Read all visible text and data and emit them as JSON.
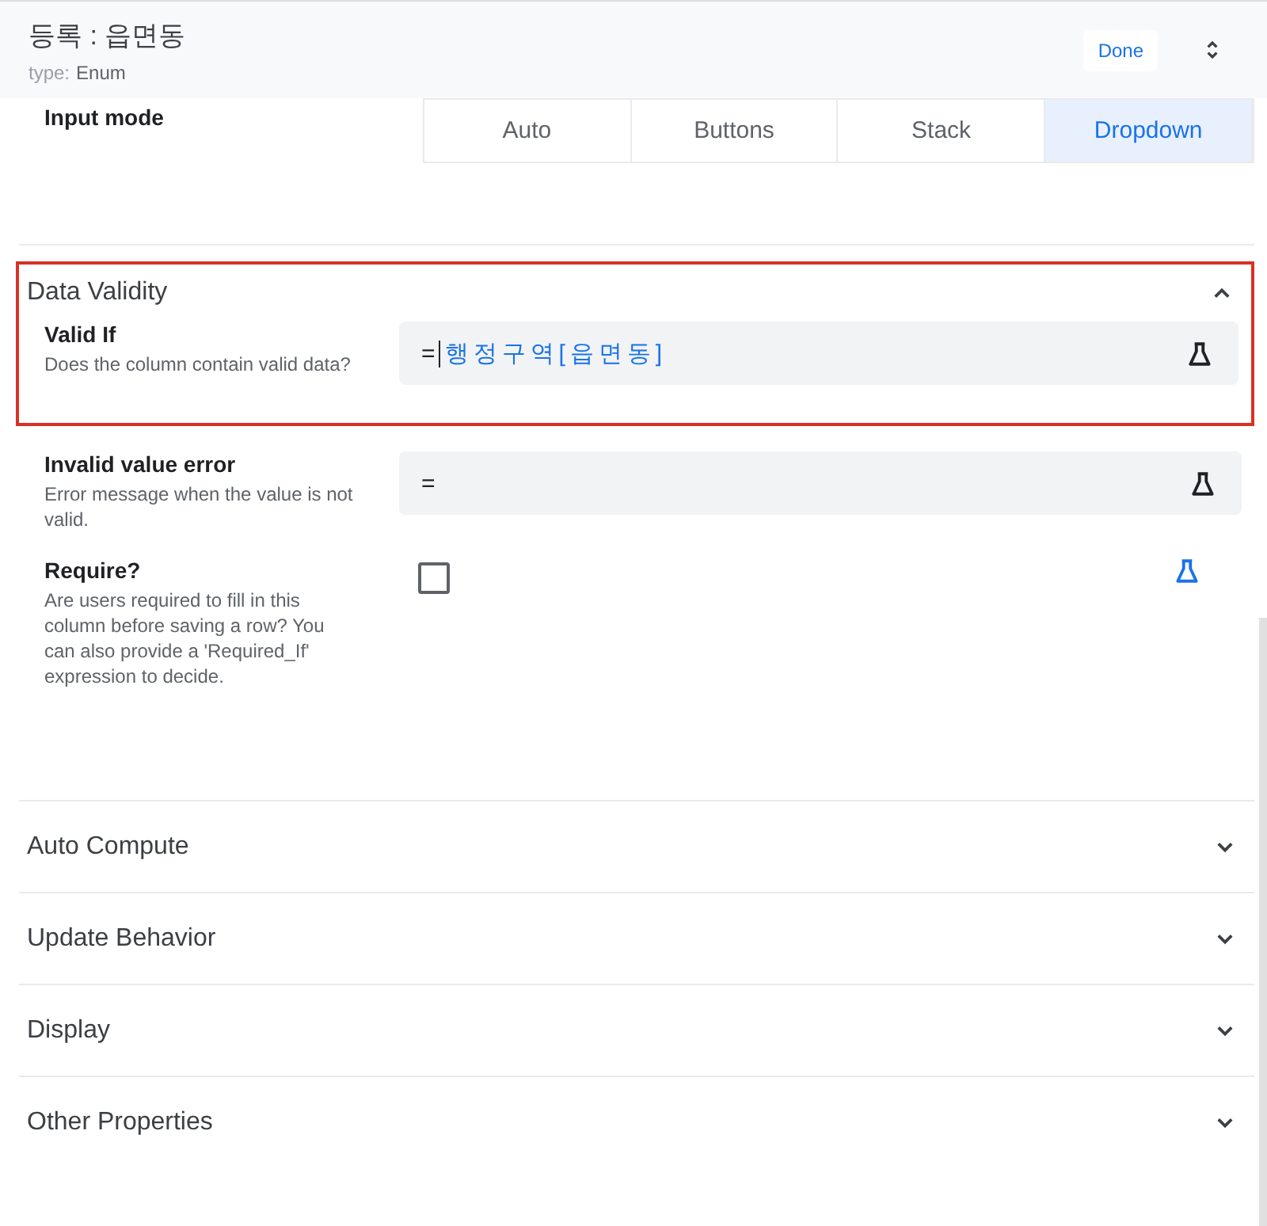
{
  "header": {
    "title": "등록 : 읍면동",
    "type_label": "type:",
    "type_value": "Enum",
    "done": "Done"
  },
  "input_mode": {
    "label": "Input mode",
    "options": [
      {
        "label": "Auto",
        "selected": false
      },
      {
        "label": "Buttons",
        "selected": false
      },
      {
        "label": "Stack",
        "selected": false
      },
      {
        "label": "Dropdown",
        "selected": true
      }
    ]
  },
  "sections": [
    {
      "title": "Data Validity",
      "expanded": true,
      "fields": [
        {
          "kind": "formula",
          "label": "Valid If",
          "description": "Does the column contain valid data?",
          "prefix": "=",
          "value": "행정구역[읍면동]",
          "highlighted": true,
          "formula_on": false
        },
        {
          "kind": "formula",
          "label": "Invalid value error",
          "description": "Error message when the value is not valid.",
          "prefix": "=",
          "highlighted": false,
          "formula_on": false
        },
        {
          "kind": "checkbox",
          "label": "Require?",
          "description": "Are users required to fill in this column before saving a row? You can also provide a 'Required_If' expression to decide.",
          "checked": false,
          "highlighted": false,
          "formula_on": true
        }
      ]
    },
    {
      "title": "Auto Compute",
      "expanded": false
    },
    {
      "title": "Update Behavior",
      "expanded": false
    },
    {
      "title": "Display",
      "expanded": false
    },
    {
      "title": "Other Properties",
      "expanded": false
    }
  ]
}
